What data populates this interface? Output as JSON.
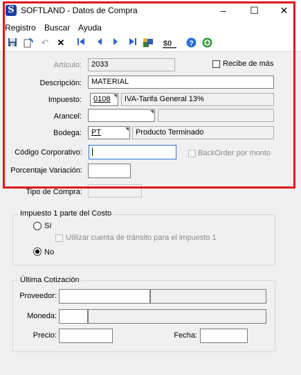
{
  "window": {
    "app_icon_letter": "S",
    "title": "SOFTLAND - Datos de Compra",
    "minimize": "–",
    "maximize": "☐",
    "close": "✕"
  },
  "menu": [
    "Registro",
    "Buscar",
    "Ayuda"
  ],
  "toolbar_icons": [
    "save-icon",
    "refresh-icon",
    "undo-icon",
    "delete-icon",
    "first-record-icon",
    "previous-record-icon",
    "next-record-icon",
    "last-record-icon",
    "search-tools-icon",
    "toggle-icon",
    "help-icon",
    "add-icon"
  ],
  "form": {
    "articulo_label": "Artículo:",
    "articulo_value": "2033",
    "recibe_mas_label": "Recibe de más",
    "descripcion_label": "Descripción:",
    "descripcion_value": "MATERIAL",
    "impuesto_label": "Impuesto:",
    "impuesto_code": "0108",
    "impuesto_desc": "IVA-Tarifa General 13%",
    "arancel_label": "Arancel:",
    "arancel_code": "",
    "arancel_desc": "",
    "bodega_label": "Bodega:",
    "bodega_code": "PT",
    "bodega_desc": "Producto Terminado",
    "codigo_corp_label": "Código Corporativo:",
    "codigo_corp_value": "",
    "backorder_label": "BackOrder por monto",
    "porcentaje_label": "Porcentaje Variación:",
    "porcentaje_value": "",
    "tipo_compra_label": "Tipo de Compra:"
  },
  "impuesto_group": {
    "title": "Impuesto 1 parte del Costo",
    "si_label": "Sí",
    "transito_label": "Utilizar cuenta de tránsito para el impuesto 1",
    "no_label": "No",
    "selected": "No"
  },
  "cotizacion_group": {
    "title": "Última Cotización",
    "proveedor_label": "Proveedor:",
    "moneda_label": "Moneda:",
    "precio_label": "Precio:",
    "fecha_label": "Fecha:"
  },
  "colors": {
    "highlight": "#e0141a",
    "field_border": "#7a7a7a",
    "window_bg": "#f0f0f0"
  }
}
